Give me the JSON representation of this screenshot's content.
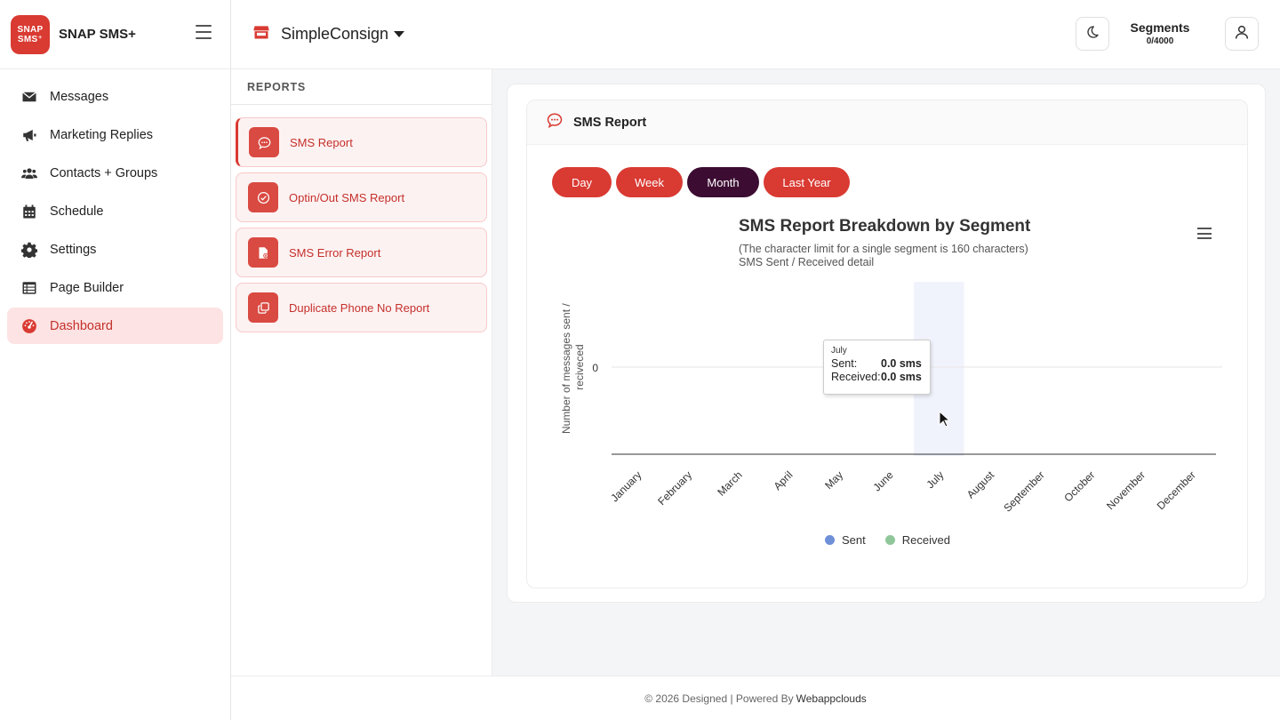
{
  "brand": {
    "logo_line1": "SNAP",
    "logo_line2": "SMS⁺",
    "name": "SNAP SMS+"
  },
  "sidebar": {
    "items": [
      {
        "label": "Messages",
        "icon": "envelope-icon"
      },
      {
        "label": "Marketing Replies",
        "icon": "megaphone-icon"
      },
      {
        "label": "Contacts + Groups",
        "icon": "users-icon"
      },
      {
        "label": "Schedule",
        "icon": "calendar-icon"
      },
      {
        "label": "Settings",
        "icon": "gear-icon"
      },
      {
        "label": "Page Builder",
        "icon": "table-list-icon"
      },
      {
        "label": "Dashboard",
        "icon": "gauge-icon",
        "active": true
      }
    ]
  },
  "header": {
    "store_name": "SimpleConsign",
    "segments_title": "Segments",
    "segments_count": "0/4000"
  },
  "reports": {
    "heading": "REPORTS",
    "items": [
      {
        "label": "SMS Report",
        "icon": "chat-icon",
        "active": true
      },
      {
        "label": "Optin/Out SMS Report",
        "icon": "check-circle-icon"
      },
      {
        "label": "SMS Error Report",
        "icon": "file-error-icon"
      },
      {
        "label": "Duplicate Phone No Report",
        "icon": "copy-icon"
      }
    ]
  },
  "card": {
    "title": "SMS Report",
    "period_buttons": [
      "Day",
      "Week",
      "Month",
      "Last Year"
    ],
    "active_period": "Month"
  },
  "chart_data": {
    "type": "column",
    "title": "SMS Report Breakdown by Segment",
    "subtitle": "(The character limit for a single segment is 160 characters)",
    "subtitle2": "SMS Sent / Received detail",
    "ylabel": "Number of messages sent / reciveced",
    "xlabel": "",
    "y_tick_labels": [
      "0"
    ],
    "categories": [
      "January",
      "February",
      "March",
      "April",
      "May",
      "June",
      "July",
      "August",
      "September",
      "October",
      "November",
      "December"
    ],
    "series": [
      {
        "name": "Sent",
        "color": "#6f8fd8",
        "values": [
          0,
          0,
          0,
          0,
          0,
          0,
          0,
          0,
          0,
          0,
          0,
          0
        ]
      },
      {
        "name": "Received",
        "color": "#8fc79a",
        "values": [
          0,
          0,
          0,
          0,
          0,
          0,
          0,
          0,
          0,
          0,
          0,
          0
        ]
      }
    ],
    "highlighted_category": "July",
    "tooltip": {
      "month": "July",
      "sent_label": "Sent:",
      "sent_value": "0.0 sms",
      "received_label": "Received:",
      "received_value": "0.0 sms"
    },
    "legend_position": "bottom-center"
  },
  "footer": {
    "text": "© 2026 Designed | Powered By",
    "link": "Webappclouds"
  }
}
